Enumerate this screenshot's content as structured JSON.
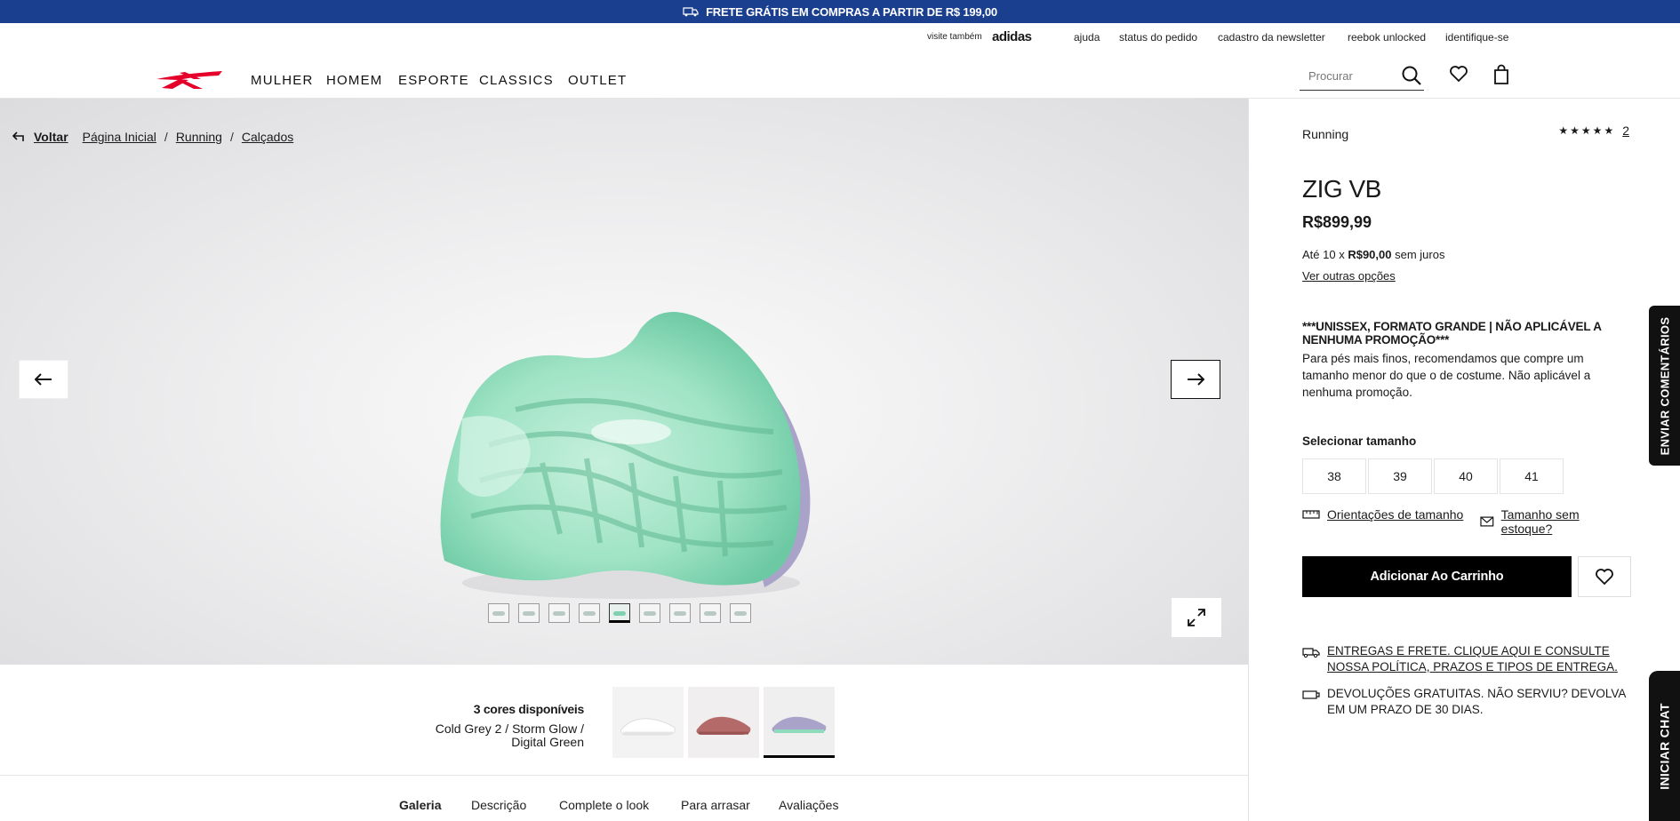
{
  "promo": {
    "text": "FRETE GRÁTIS EM COMPRAS A PARTIR DE R$ 199,00"
  },
  "utility": {
    "visit_label": "visite também",
    "partner": "adidas",
    "links": [
      "ajuda",
      "status do pedido",
      "cadastro da newsletter",
      "reebok unlocked",
      "identifique-se"
    ]
  },
  "nav": {
    "items": [
      "MULHER",
      "HOMEM",
      "ESPORTE",
      "CLASSICS",
      "OUTLET"
    ]
  },
  "search": {
    "placeholder": "Procurar"
  },
  "breadcrumb": {
    "back": "Voltar",
    "items": [
      "Página Inicial",
      "Running",
      "Calçados"
    ],
    "separator": "/"
  },
  "gallery": {
    "thumbnail_count": 9,
    "active_thumbnail": 5
  },
  "variants": {
    "count_label": "3 cores disponíveis",
    "selected_name": "Cold Grey 2 / Storm Glow / Digital Green"
  },
  "tabs": [
    "Galeria",
    "Descrição",
    "Complete o look",
    "Para arrasar",
    "Avaliações"
  ],
  "product": {
    "category": "Running",
    "stars": "★★★★★",
    "rating_count": "2",
    "name": "ZIG VB",
    "price": "R$899,99",
    "install_prefix": "Até 10 x",
    "install_value": "R$90,00",
    "install_suffix": "sem juros",
    "other_options": "Ver outras opções",
    "notice_title": "***UNISSEX, FORMATO GRANDE | NÃO APLICÁVEL A NENHUMA PROMOÇÃO***",
    "notice_body": "Para pés mais finos, recomendamos que compre um tamanho menor do que o de costume. Não aplicável a nenhuma promoção.",
    "size_label": "Selecionar tamanho",
    "sizes": [
      "38",
      "39",
      "40",
      "41"
    ],
    "size_guide": "Orientações de tamanho",
    "out_of_stock": "Tamanho sem estoque?",
    "add_to_cart": "Adicionar Ao Carrinho",
    "shipping": "ENTREGAS E FRETE. CLIQUE AQUI E CONSULTE NOSSA POLÍTICA, PRAZOS E TIPOS DE ENTREGA.",
    "returns": "DEVOLUÇÕES GRATUITAS. NÃO SERVIU? DEVOLVA EM UM PRAZO DE 30 DIAS."
  },
  "side": {
    "feedback": "ENVIAR COMENTÁRIOS",
    "chat": "INICIAR CHAT"
  },
  "colors": {
    "promo_bg": "#1b3f8f",
    "logo_red": "#e4002b",
    "accent_black": "#000000",
    "sole_mint": "#9fe3c5"
  }
}
